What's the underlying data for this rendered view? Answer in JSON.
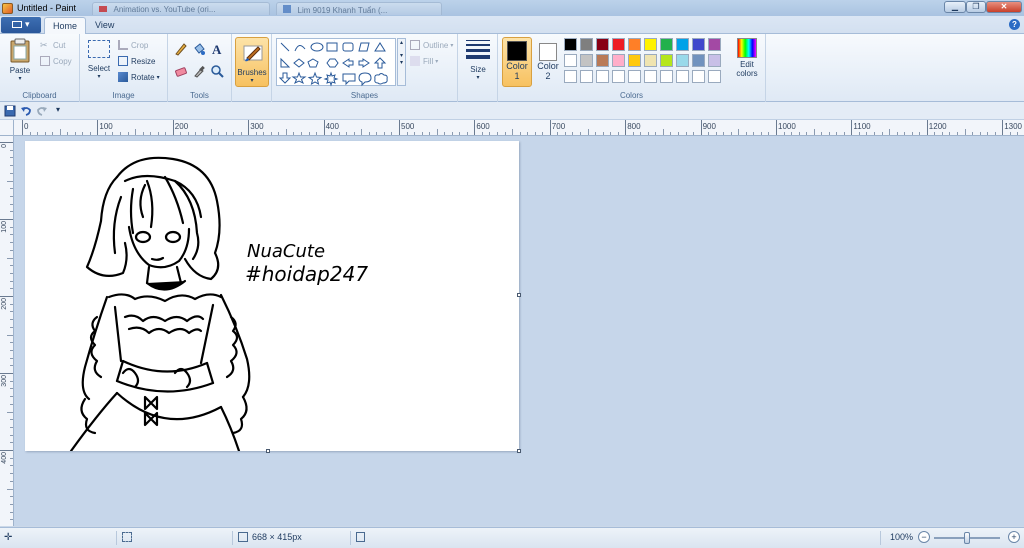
{
  "window": {
    "title": "Untitled - Paint",
    "background_tabs": [
      "Animation vs. YouTube (ori...",
      "Lim 9019 Khanh Tuẩn (..."
    ]
  },
  "ribbon_tabs": {
    "file_label": "▾",
    "home": "Home",
    "view": "View"
  },
  "clipboard": {
    "paste": "Paste",
    "cut": "Cut",
    "copy": "Copy",
    "label": "Clipboard"
  },
  "image": {
    "select": "Select",
    "crop": "Crop",
    "resize": "Resize",
    "rotate": "Rotate",
    "label": "Image"
  },
  "tools": {
    "label": "Tools"
  },
  "brushes": {
    "label": "Brushes"
  },
  "shapes": {
    "outline": "Outline",
    "fill": "Fill",
    "label": "Shapes"
  },
  "size": {
    "label": "Size"
  },
  "colors": {
    "color1_label": "Color",
    "color1_num": "1",
    "color2_label": "Color",
    "color2_num": "2",
    "edit_label_1": "Edit",
    "edit_label_2": "colors",
    "label": "Colors",
    "color1": "#000000",
    "color2": "#ffffff",
    "palette": [
      "#000000",
      "#7f7f7f",
      "#880015",
      "#ed1c24",
      "#ff7f27",
      "#fff200",
      "#22b14c",
      "#00a2e8",
      "#3f48cc",
      "#a349a4",
      "#ffffff",
      "#c3c3c3",
      "#b97a57",
      "#ffaec9",
      "#ffc90e",
      "#efe4b0",
      "#b5e61d",
      "#99d9ea",
      "#7092be",
      "#c8bfe7",
      "#ffffff",
      "#ffffff",
      "#ffffff",
      "#ffffff",
      "#ffffff",
      "#ffffff",
      "#ffffff",
      "#ffffff",
      "#ffffff",
      "#ffffff"
    ]
  },
  "ruler": {
    "h_ticks": [
      "0",
      "100",
      "200",
      "300",
      "400",
      "500",
      "600",
      "700",
      "800",
      "900",
      "1000",
      "1100",
      "1200",
      "1300"
    ],
    "v_ticks": [
      "0",
      "100",
      "200",
      "300",
      "400"
    ]
  },
  "drawing": {
    "text_line1": "NuaCute",
    "text_line2": "#hoidap247"
  },
  "statusbar": {
    "image_size": "668 × 415px",
    "zoom": "100%",
    "zoom_level": 1.0
  }
}
